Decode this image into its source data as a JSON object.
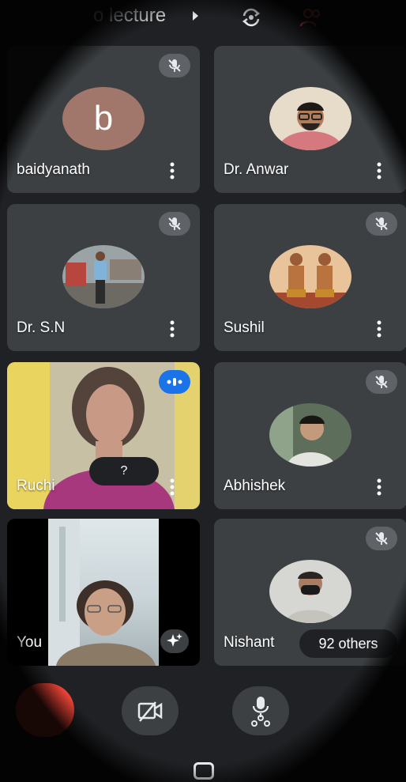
{
  "header": {
    "meeting_title": "o lecture",
    "chevron_icon": "chevron-right-icon",
    "flip_camera_icon": "flip-camera-icon",
    "people_icon": "people-icon"
  },
  "tiles": [
    {
      "name": "baidyanath",
      "avatar_letter": "b",
      "muted": true
    },
    {
      "name": "Dr. Anwar",
      "muted": false
    },
    {
      "name": "Dr. S.N",
      "muted": true
    },
    {
      "name": "Sushil",
      "muted": true
    },
    {
      "name": "Ruchi",
      "speaking": true,
      "chip": "?"
    },
    {
      "name": "Abhishek",
      "muted": true
    },
    {
      "name": "You",
      "self": true
    },
    {
      "name": "Nishant",
      "muted": true,
      "others_chip": "92 others"
    }
  ],
  "controls": {
    "camera_icon": "camera-off-icon",
    "mic_icon": "mic-icon",
    "end_call_icon": "end-call-icon"
  },
  "colors": {
    "background": "#202124",
    "tile": "#3c4043",
    "mute_badge": "#5f6368",
    "speaking_badge": "#1a73e8",
    "end_call": "#ea4335",
    "people_accent": "#ea6a5a"
  }
}
